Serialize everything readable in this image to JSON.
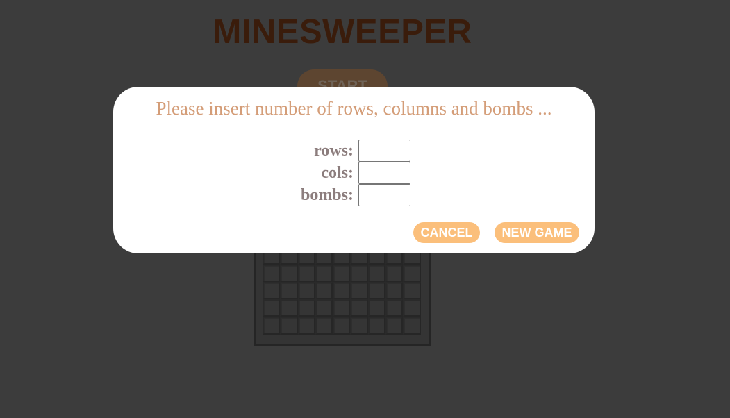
{
  "game": {
    "title": "MINESWEEPER",
    "start_label": "START",
    "board": {
      "rows": 6,
      "cols": 9
    }
  },
  "dialog": {
    "prompt": "Please insert number of rows, columns and bombs ...",
    "fields": [
      {
        "label": "rows:",
        "value": ""
      },
      {
        "label": "cols:",
        "value": ""
      },
      {
        "label": "bombs:",
        "value": ""
      }
    ],
    "cancel_label": "CANCEL",
    "new_game_label": "NEW GAME"
  },
  "colors": {
    "background": "#3c3c3c",
    "title": "#3a1c0b",
    "accent": "#fbbf7b",
    "prompt": "#d49d78",
    "label": "#8c7d7d"
  }
}
